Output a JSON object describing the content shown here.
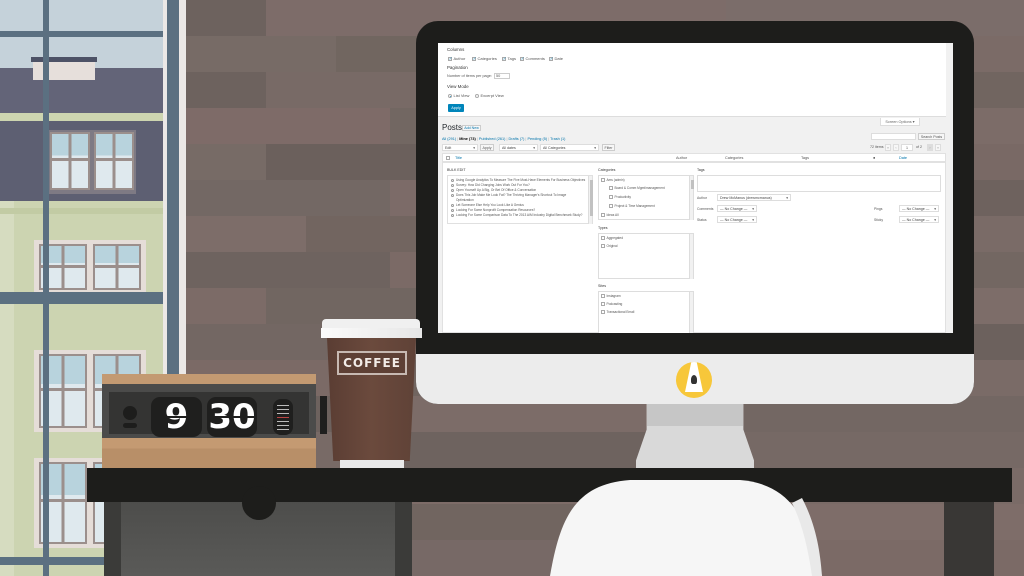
{
  "scene": {
    "clock": {
      "hour": "9",
      "minute": "30"
    },
    "coffee_label": "COFFEE",
    "monitor_logo": "lightbulb-logo"
  },
  "screen_options": {
    "columns_label": "Columns",
    "columns": [
      {
        "label": "Author",
        "checked": true
      },
      {
        "label": "Categories",
        "checked": true
      },
      {
        "label": "Tags",
        "checked": true
      },
      {
        "label": "Comments",
        "checked": true
      },
      {
        "label": "Date",
        "checked": true
      }
    ],
    "pagination_label": "Pagination",
    "per_page_label": "Number of items per page:",
    "per_page_value": "50",
    "view_mode_label": "View Mode",
    "view_modes": [
      {
        "label": "List View",
        "selected": true
      },
      {
        "label": "Excerpt View",
        "selected": false
      }
    ],
    "apply_label": "Apply",
    "toggle_label": "Screen Options ▾"
  },
  "posts": {
    "title": "Posts",
    "add_new": "Add New",
    "filters": [
      {
        "label": "All (291)"
      },
      {
        "label": "Mine (73)",
        "current": true
      },
      {
        "label": "Published (261)"
      },
      {
        "label": "Drafts (7)"
      },
      {
        "label": "Pending (5)"
      },
      {
        "label": "Trash (1)"
      }
    ],
    "search_button": "Search Posts",
    "bulk_action": "Edit",
    "apply": "Apply",
    "date_filter": "All dates",
    "category_filter": "All Categories",
    "filter_button": "Filter",
    "items_count": "72 items",
    "page_current": "1",
    "page_total": "of 2",
    "pager": [
      "«",
      "‹",
      "›",
      "»"
    ],
    "columns": {
      "title": "Title",
      "author": "Author",
      "categories": "Categories",
      "tags": "Tags",
      "comments_icon": "comment-bubble-icon",
      "date": "Date"
    }
  },
  "bulk_edit": {
    "heading": "Bulk Edit",
    "items": [
      "Using Google Analytics To Measure The Five Must-Have Elements For Business Objectives",
      "Survey: How Did Changing Jobs Work Out For You?",
      "Open Yourself Up A Big, Or Bet Of Office & Conversation",
      "Does This Job Make Me Look Fat? The Thriving Manager's Shortcut To Image",
      "Optimization",
      "Let Someone Else Help You Look Like A Genius",
      "Looking For Some Nonprofit Compensation Resources?",
      "Looking For Some Comparison Data To The 2013 AIM Industry Digital Benchmark Study?"
    ],
    "categories_label": "Categories",
    "categories": [
      {
        "label": "Ams (admin)",
        "level": 0
      },
      {
        "label": "Board & Comm Mgmt/management",
        "level": 1
      },
      {
        "label": "Productivity",
        "level": 1
      },
      {
        "label": "Project & Time Management",
        "level": 1
      },
      {
        "label": "Ideas All",
        "level": 0
      }
    ],
    "types_label": "Types",
    "types": [
      "Aggregated",
      "Original"
    ],
    "sites_label": "Sites",
    "sites": [
      "Instagram",
      "Podcasting",
      "Transactional Email"
    ],
    "tags_label": "Tags",
    "author_label": "Author",
    "author_value": "Drew McManus (drewmcmanus)",
    "comments_label": "Comments",
    "comments_value": "— No Change —",
    "status_label": "Status",
    "status_value": "— No Change —",
    "pings_label": "Pings",
    "pings_value": "— No Change —",
    "sticky_label": "Sticky",
    "sticky_value": "— No Change —"
  }
}
